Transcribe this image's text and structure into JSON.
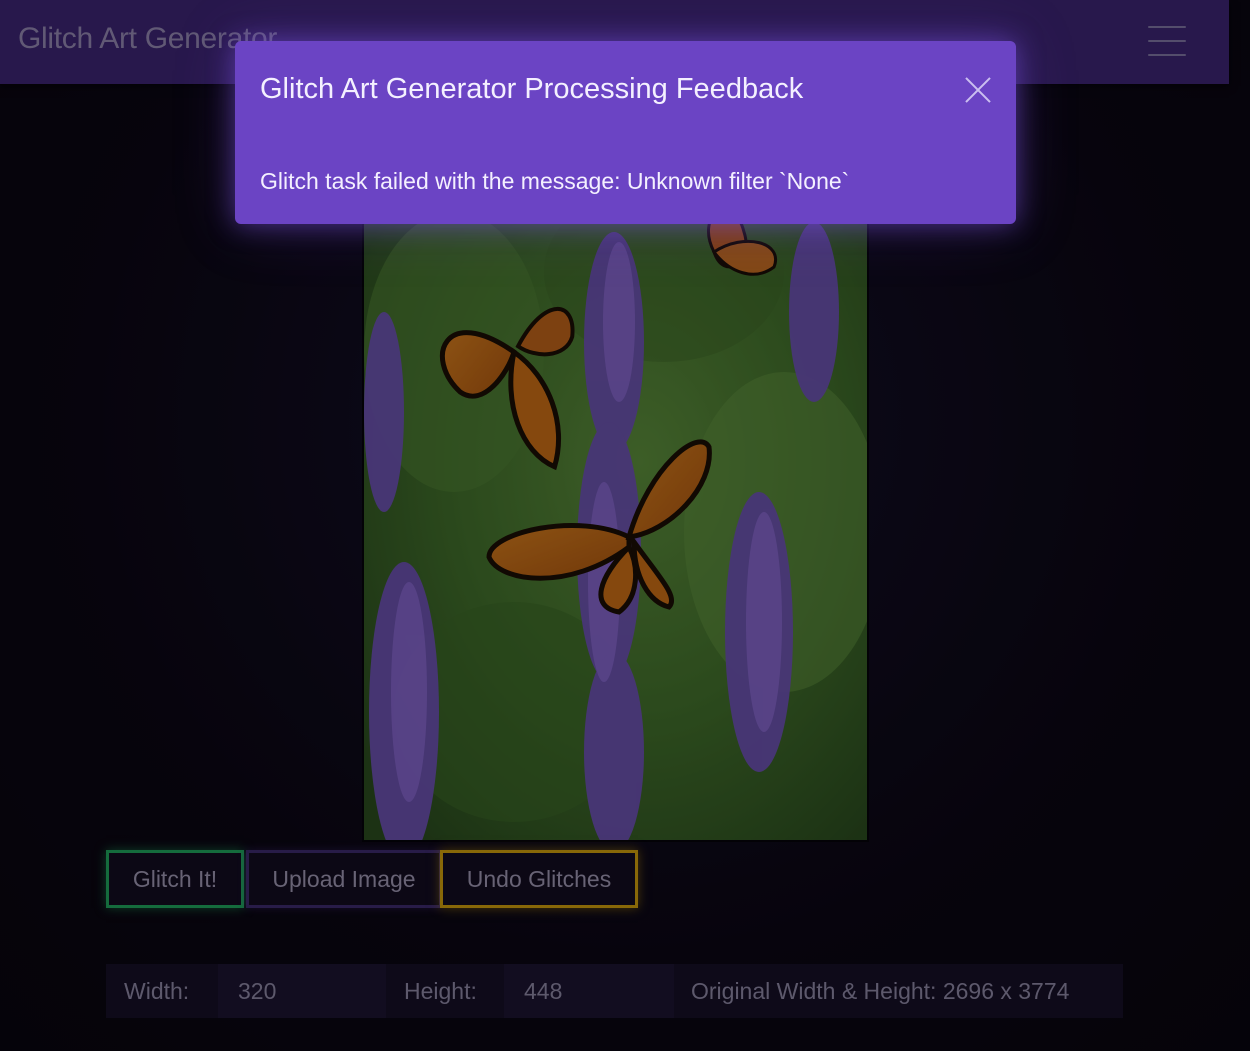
{
  "navbar": {
    "brand": "Glitch Art Generator",
    "menu_icon": "hamburger-menu-icon"
  },
  "image": {
    "description_icon": "butterfly-photo"
  },
  "buttons": {
    "glitch": "Glitch It!",
    "upload": "Upload Image",
    "undo": "Undo Glitches"
  },
  "dimensions": {
    "width_label": "Width:",
    "width_value": "320",
    "height_label": "Height:",
    "height_value": "448",
    "original": "Original Width & Height: 2696 x 3774"
  },
  "modal": {
    "title": "Glitch Art Generator Processing Feedback",
    "message": "Glitch task failed with the message: Unknown filter `None`",
    "close_icon": "close-icon"
  },
  "colors": {
    "accent_green": "#1fa05a",
    "accent_purple": "#3b2a6a",
    "accent_gold": "#c99a0c",
    "modal_bg": "#6b44c4",
    "navbar_bg": "#3b2470"
  }
}
